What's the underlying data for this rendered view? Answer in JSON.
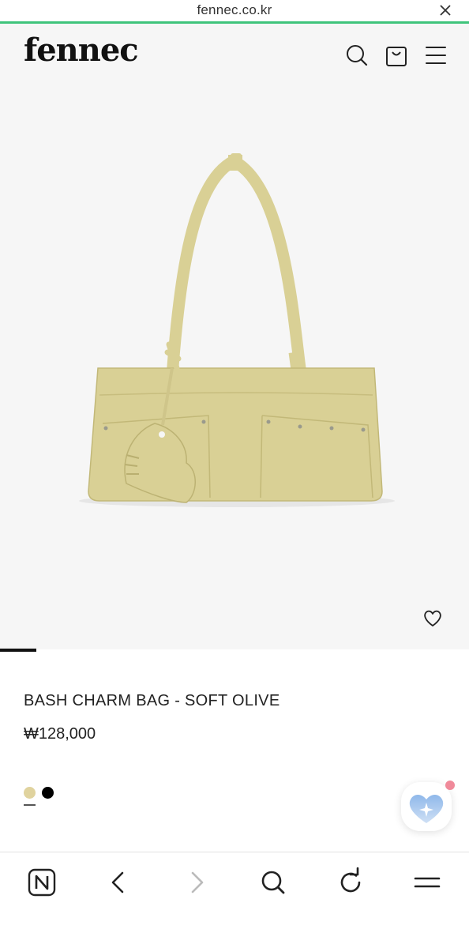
{
  "browser": {
    "url": "fennec.co.kr",
    "progress_color": "#3fc47b"
  },
  "header": {
    "logo": "fennec",
    "icons": [
      "search-icon",
      "shopping-bag-icon",
      "menu-icon"
    ]
  },
  "product": {
    "name": "BASH CHARM BAG - SOFT OLIVE",
    "price": "₩128,000",
    "bag_color": "#d9d095",
    "colors": [
      {
        "name": "soft-olive",
        "hex": "#e0d39e",
        "selected": true
      },
      {
        "name": "black",
        "hex": "#000000",
        "selected": false
      }
    ],
    "wishlist_icon": "heart-outline-icon"
  },
  "floating_button": {
    "icon": "heart-sparkle-icon",
    "notification_color": "#f08a9a"
  },
  "toolbar": {
    "icons": [
      "naver-n-icon",
      "back-icon",
      "forward-icon",
      "search-icon",
      "refresh-icon",
      "menu-icon"
    ]
  }
}
